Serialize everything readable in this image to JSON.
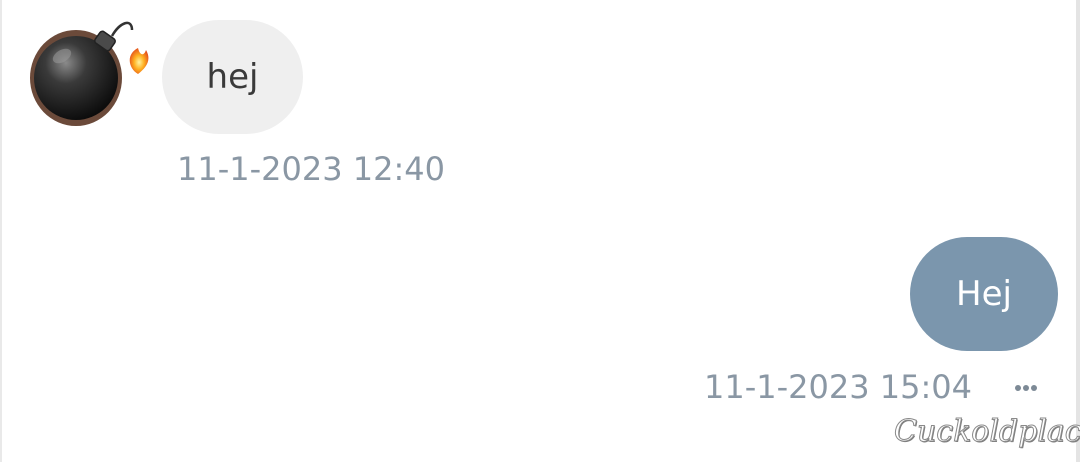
{
  "conversation": {
    "incoming": {
      "avatar_icon": "bomb-icon",
      "message": "hej",
      "timestamp": "11-1-2023 12:40"
    },
    "outgoing": {
      "message": "Hej",
      "timestamp": "11-1-2023 15:04",
      "more_icon": "more-dots-icon"
    }
  },
  "watermark": {
    "text": "Cuckoldplace"
  },
  "colors": {
    "incoming_bubble": "#efefef",
    "outgoing_bubble": "#7b96ad",
    "timestamp_text": "#8a97a4"
  }
}
